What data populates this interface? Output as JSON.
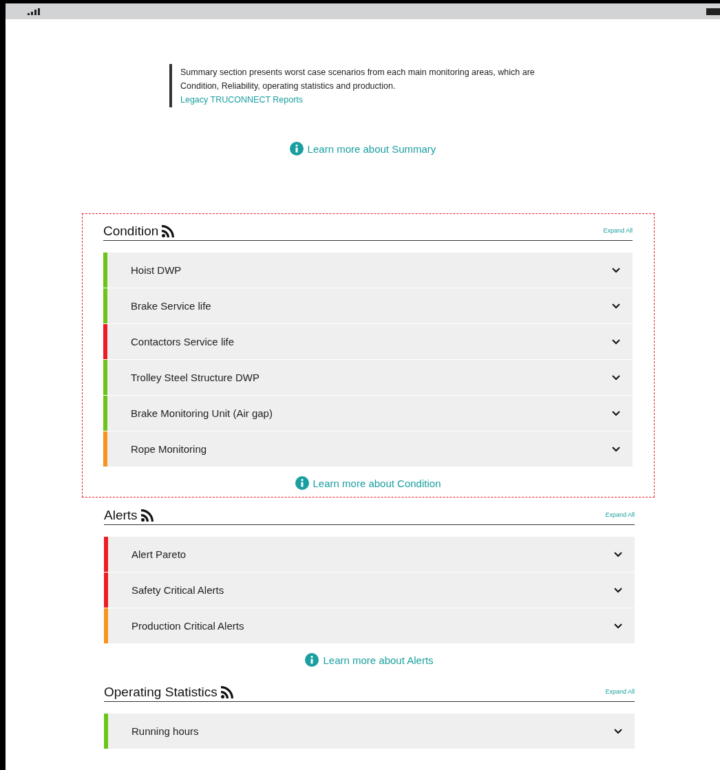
{
  "intro": {
    "text": "Summary section presents worst case scenarios from each main monitoring areas, which are Condition, Reliability, operating statistics and production.",
    "link": "Legacy TRUCONNECT Reports"
  },
  "summary_link": "Learn more about Summary",
  "sections": [
    {
      "title": "Condition",
      "highlighted": true,
      "expand_label": "Expand All",
      "learn_more": "Learn more about Condition",
      "items": [
        {
          "label": "Hoist DWP",
          "color": "#6cc417"
        },
        {
          "label": "Brake Service life",
          "color": "#6cc417"
        },
        {
          "label": "Contactors Service life",
          "color": "#ee1c25"
        },
        {
          "label": "Trolley Steel Structure DWP",
          "color": "#6cc417"
        },
        {
          "label": "Brake Monitoring Unit (Air gap)",
          "color": "#6cc417"
        },
        {
          "label": "Rope Monitoring",
          "color": "#f7941d"
        }
      ]
    },
    {
      "title": "Alerts",
      "highlighted": false,
      "expand_label": "Expand All",
      "learn_more": "Learn more about Alerts",
      "items": [
        {
          "label": "Alert Pareto",
          "color": "#ee1c25"
        },
        {
          "label": "Safety Critical Alerts",
          "color": "#ee1c25"
        },
        {
          "label": "Production Critical Alerts",
          "color": "#f7941d"
        }
      ]
    },
    {
      "title": "Operating Statistics",
      "highlighted": false,
      "expand_label": "Expand All",
      "items": [
        {
          "label": "Running hours",
          "color": "#6cc417"
        }
      ]
    }
  ]
}
